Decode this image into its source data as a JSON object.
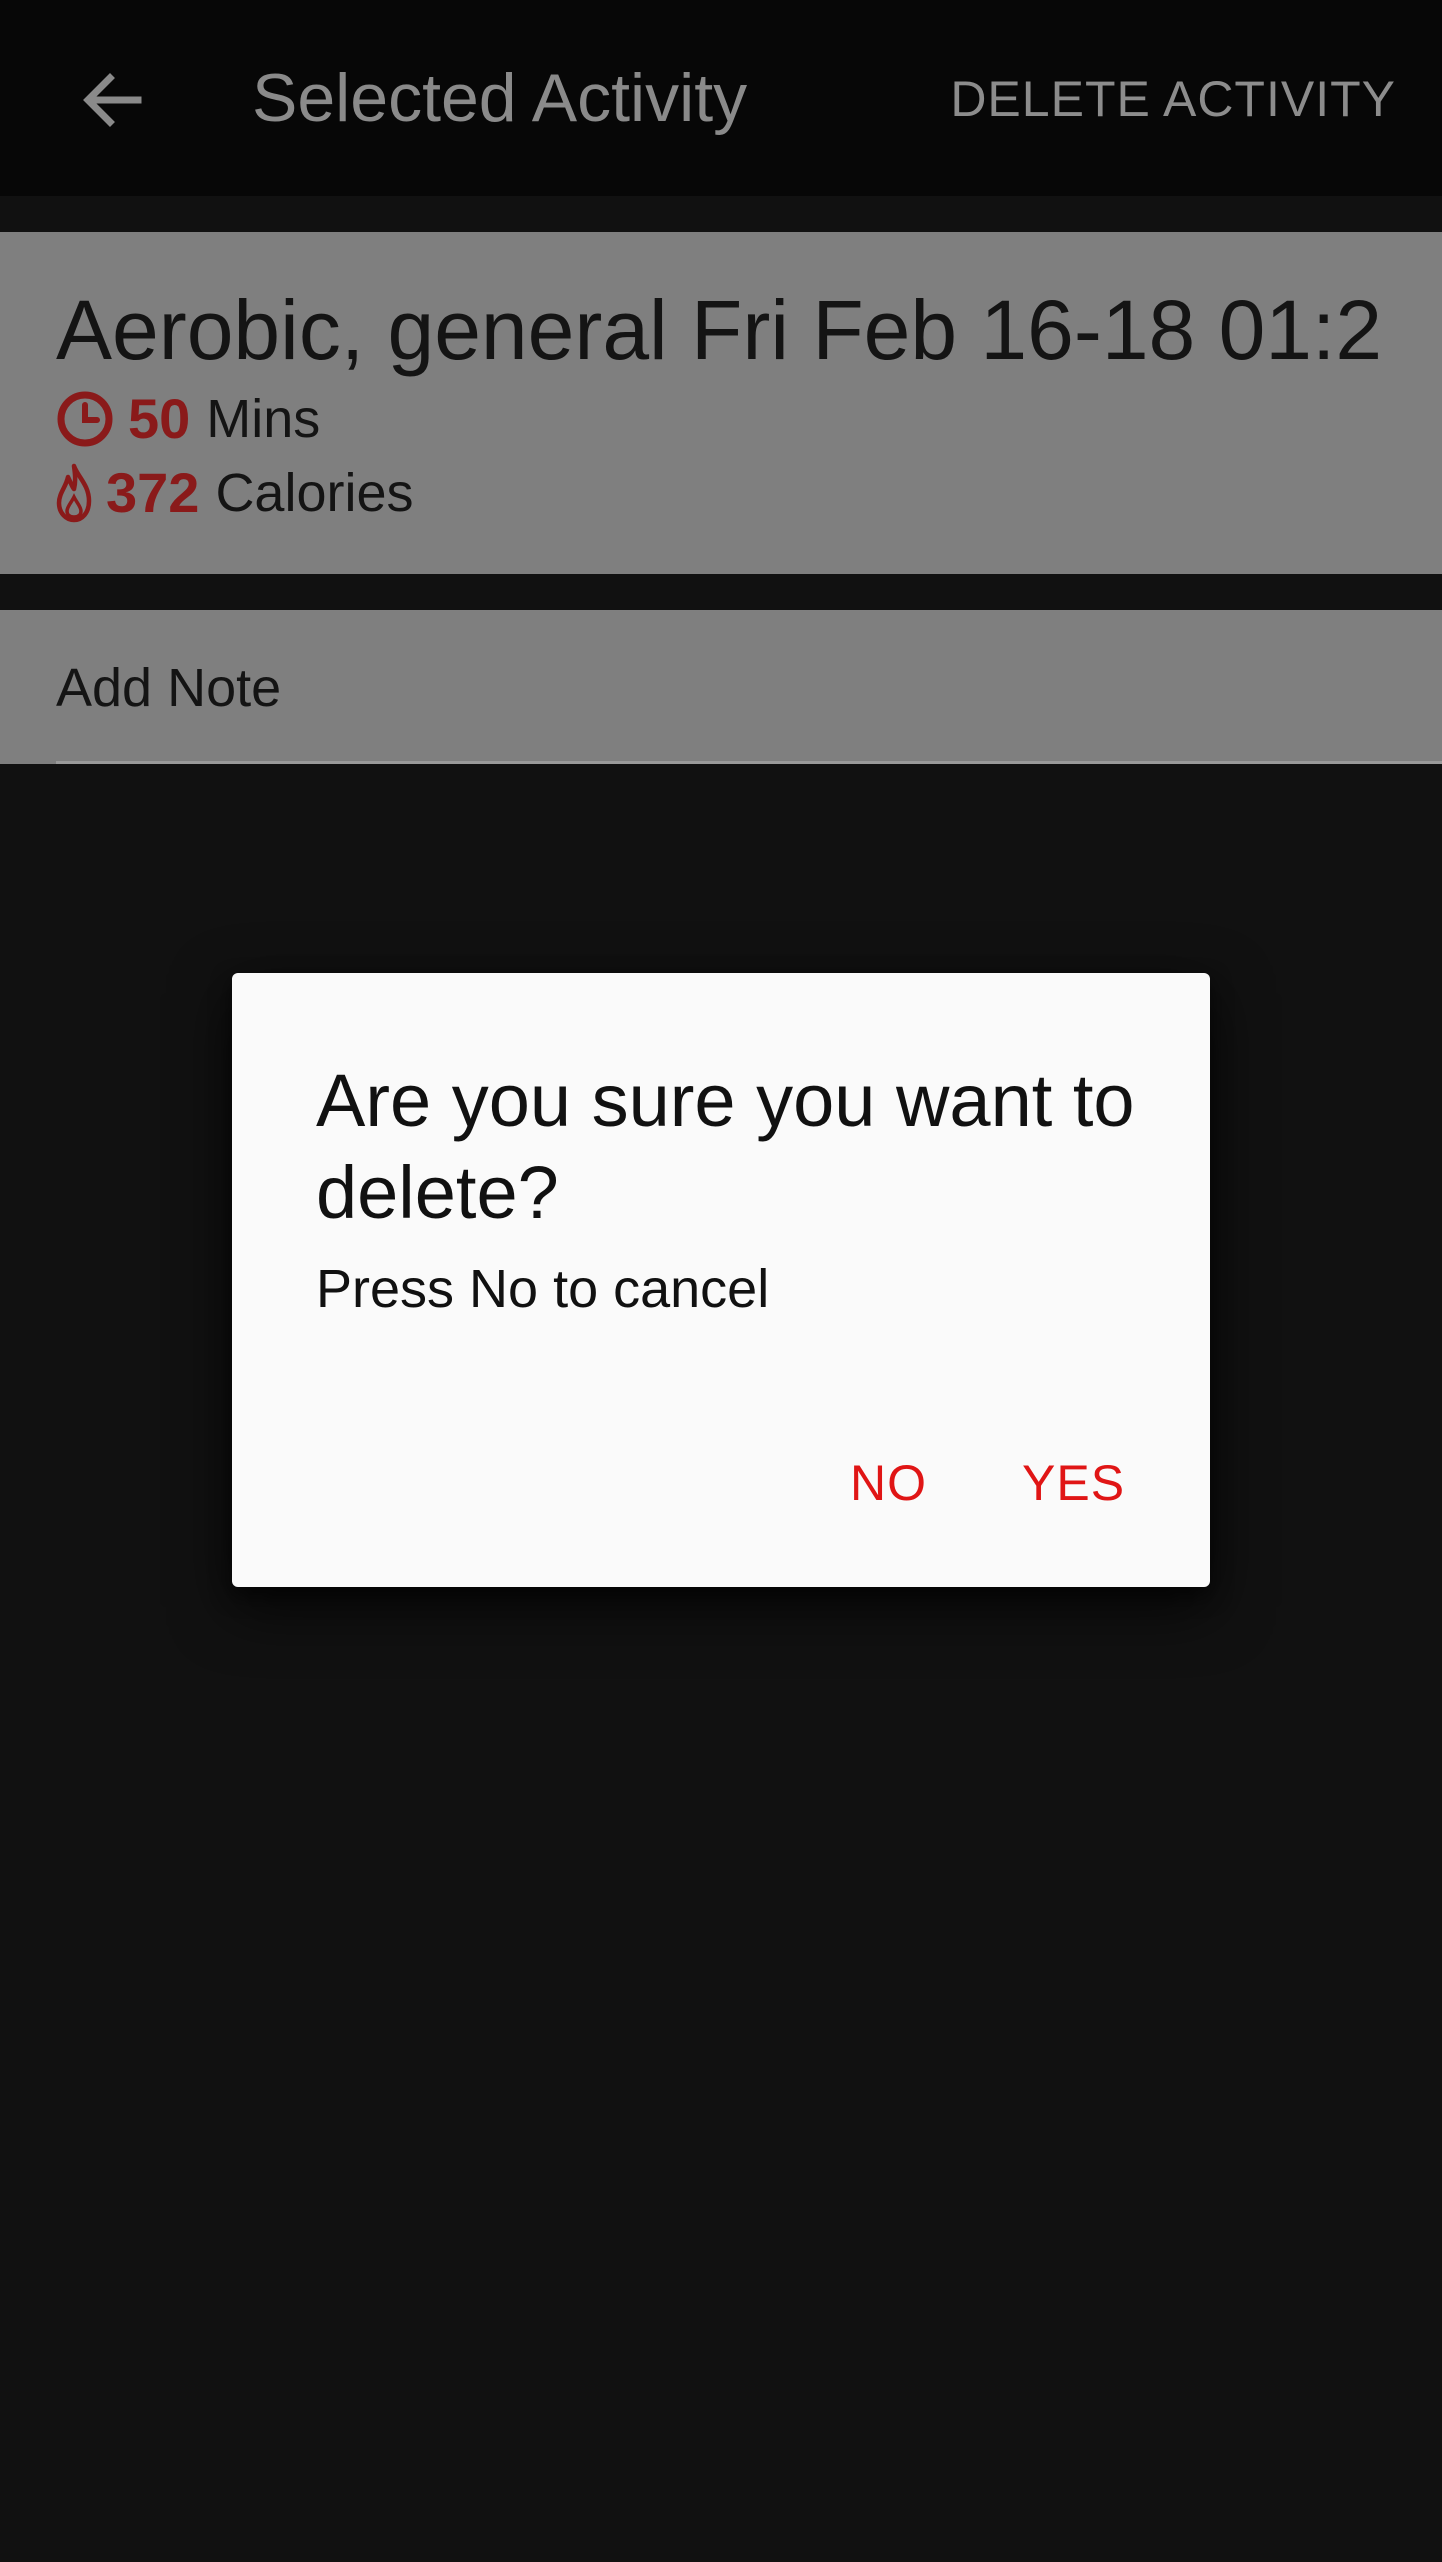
{
  "app_bar": {
    "title": "Selected Activity",
    "action_label": "DELETE ACTIVITY",
    "back_icon": "arrow-left-icon"
  },
  "activity": {
    "title": "Aerobic, general Fri Feb 16-18 01:2",
    "duration_value": "50",
    "duration_unit": "Mins",
    "duration_icon": "clock-icon",
    "calories_value": "372",
    "calories_unit": "Calories",
    "calories_icon": "flame-icon"
  },
  "note": {
    "label": "Add Note"
  },
  "dialog": {
    "title": "Are you sure you want to delete?",
    "message": "Press No to cancel",
    "no_label": "NO",
    "yes_label": "YES"
  },
  "colors": {
    "accent_red": "#e01515",
    "stat_red": "#8a1a1a",
    "card_gray": "#7f7f7f",
    "appbar_bg": "#070707",
    "page_bg": "#111111",
    "dialog_bg": "#fafafa"
  }
}
